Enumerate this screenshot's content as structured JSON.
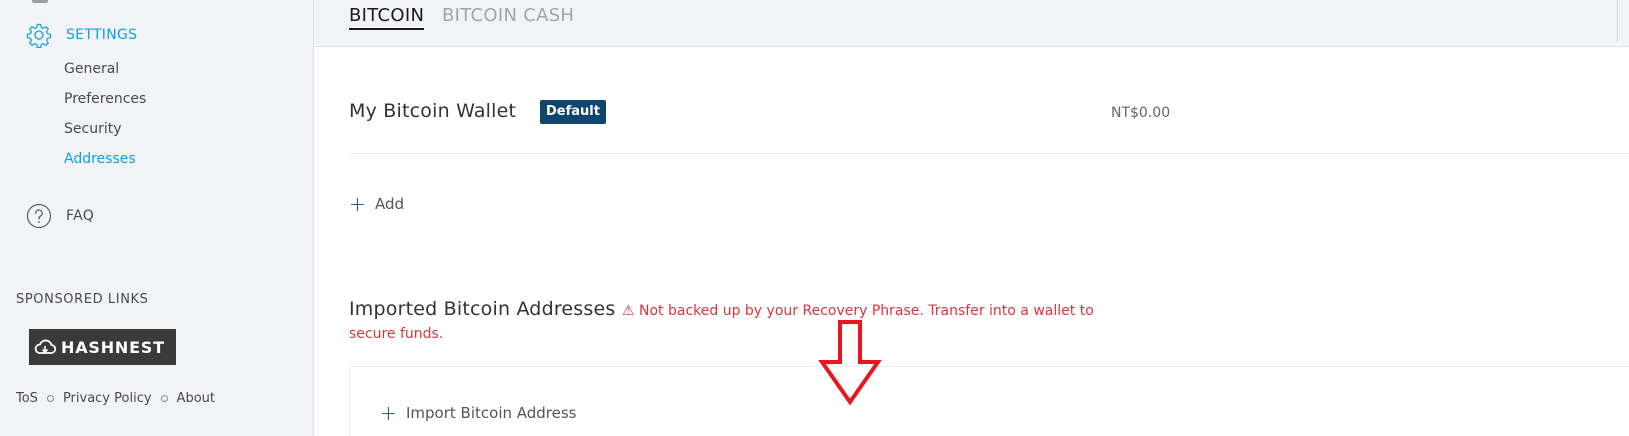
{
  "sidebar": {
    "settings_label": "SETTINGS",
    "settings_items": [
      "General",
      "Preferences",
      "Security",
      "Addresses"
    ],
    "faq_label": "FAQ",
    "sponsored_title": "SPONSORED LINKS",
    "sponsor_logo_text": "HASHNEST",
    "footer_links": [
      "ToS",
      "Privacy Policy",
      "About"
    ]
  },
  "tabs": [
    "BITCOIN",
    "BITCOIN CASH"
  ],
  "wallet": {
    "name": "My Bitcoin Wallet",
    "badge": "Default",
    "balance": "NT$0.00"
  },
  "add_label": "Add",
  "imported": {
    "title": "Imported Bitcoin Addresses",
    "warning_icon": "⚠",
    "warning": "Not backed up by your Recovery Phrase. Transfer into a wallet to secure funds.",
    "import_label": "Import Bitcoin Address"
  },
  "colors": {
    "accent": "#10a0e0",
    "badge": "#10456e",
    "warning": "#d9363e",
    "annotation": "#e8161f"
  },
  "icons": {
    "settings": "gear-icon",
    "faq": "question-circle-icon",
    "add": "plus-icon",
    "warning": "warning-triangle-icon",
    "annotation": "down-arrow-icon"
  }
}
